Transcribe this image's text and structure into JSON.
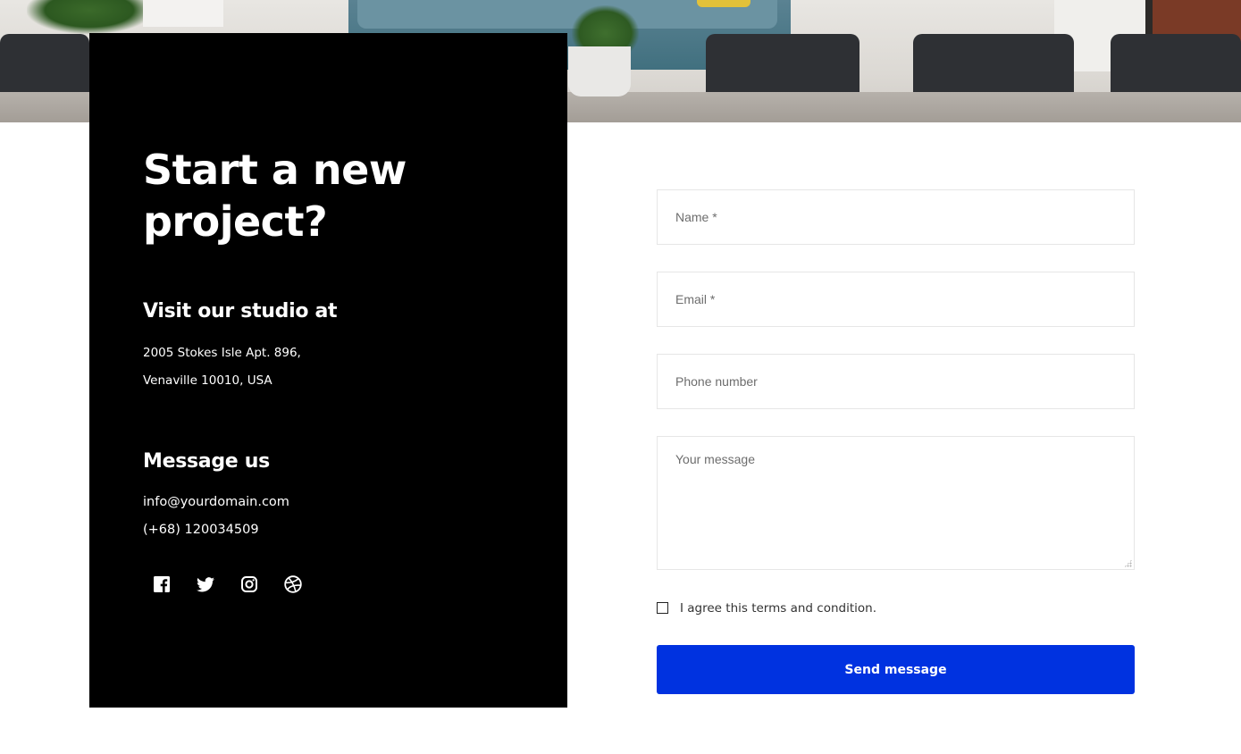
{
  "contact": {
    "title": "Start a new project?",
    "visit": {
      "heading": "Visit our studio at",
      "address_line1": "2005 Stokes Isle Apt. 896,",
      "address_line2": "Venaville 10010, USA"
    },
    "message": {
      "heading": "Message us",
      "email": "info@yourdomain.com",
      "phone": "(+68) 120034509"
    },
    "socials": [
      {
        "name": "facebook-icon"
      },
      {
        "name": "twitter-icon"
      },
      {
        "name": "instagram-icon"
      },
      {
        "name": "dribbble-icon"
      }
    ]
  },
  "form": {
    "name_placeholder": "Name *",
    "email_placeholder": "Email *",
    "phone_placeholder": "Phone number",
    "message_placeholder": "Your message",
    "agree_label": "I agree this terms and condition.",
    "agree_checked": false,
    "submit_label": "Send message"
  },
  "colors": {
    "card_bg": "#000000",
    "button_bg": "#0032e0",
    "button_text": "#ffffff"
  }
}
